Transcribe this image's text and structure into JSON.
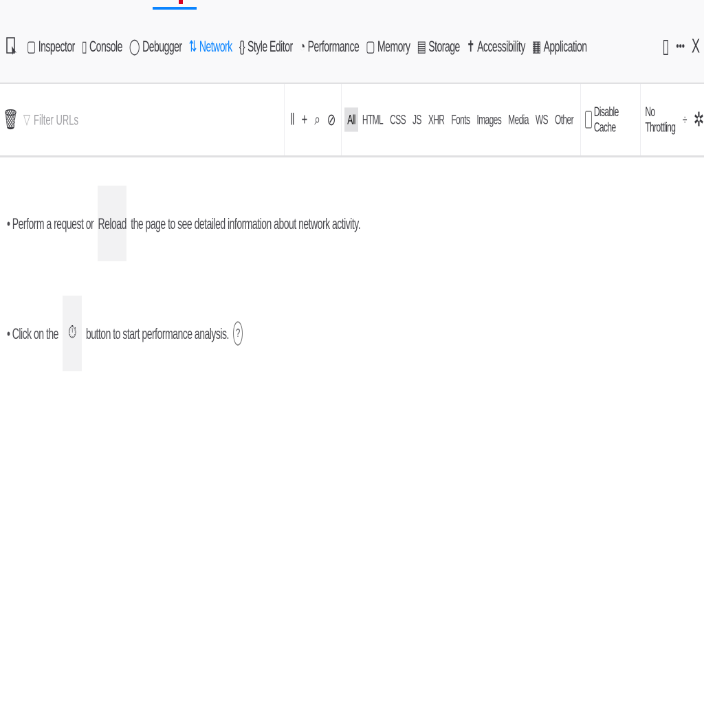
{
  "devtools": {
    "tabs": [
      {
        "label": "Inspector",
        "icon": "inspector-icon",
        "glyph": "▢"
      },
      {
        "label": "Console",
        "icon": "console-icon",
        "glyph": "▯"
      },
      {
        "label": "Debugger",
        "icon": "debugger-icon",
        "glyph": "◯"
      },
      {
        "label": "Network",
        "icon": "network-icon",
        "glyph": "⇅",
        "selected": true
      },
      {
        "label": "Style Editor",
        "icon": "style-editor-icon",
        "glyph": "{}"
      },
      {
        "label": "Performance",
        "icon": "performance-icon",
        "glyph": "◔"
      },
      {
        "label": "Memory",
        "icon": "memory-icon",
        "glyph": "▢"
      },
      {
        "label": "Storage",
        "icon": "storage-icon",
        "glyph": "▤"
      },
      {
        "label": "Accessibility",
        "icon": "accessibility-icon",
        "glyph": "✝"
      },
      {
        "label": "Application",
        "icon": "application-icon",
        "glyph": "▦"
      }
    ],
    "right_controls": {
      "responsive_glyph": "▯",
      "more_glyph": "•••",
      "close_glyph": "X"
    }
  },
  "network_toolbar": {
    "clear_glyph": "🗑",
    "filter_placeholder": "Filter URLs",
    "icons": {
      "pause": "‖",
      "add": "+",
      "search": "⌕",
      "block": "⊘"
    },
    "type_filters": [
      "All",
      "HTML",
      "CSS",
      "JS",
      "XHR",
      "Fonts",
      "Images",
      "Media",
      "WS",
      "Other"
    ],
    "disable_cache_label": "Disable Cache",
    "throttling_value": "No Throttling",
    "throttling_arrow": "÷",
    "settings_glyph": "✲"
  },
  "empty_state": {
    "line1_before": "• Perform a request or",
    "reload_label": "Reload",
    "line1_after": "the page to see detailed information about network activity.",
    "line2_before": "• Click on the",
    "perf_glyph": "⏱",
    "line2_after": "button to start performance analysis.",
    "help_glyph": "?"
  },
  "colors": {
    "accent": "#0a84ff",
    "toolbar_bg": "#f9f9fa"
  }
}
